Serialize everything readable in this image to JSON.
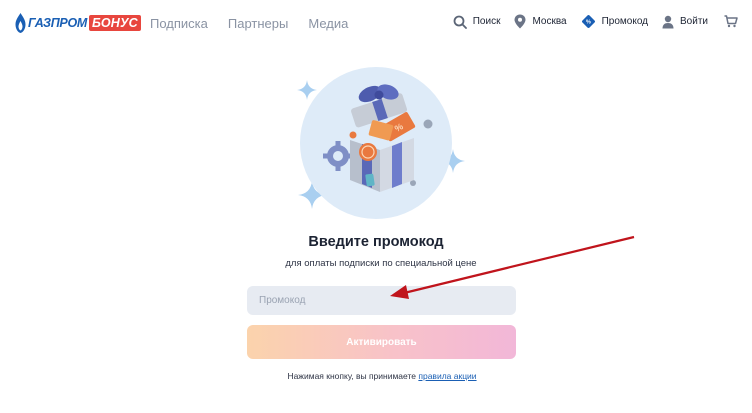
{
  "header": {
    "logo": {
      "part1": "ГАЗПРОМ",
      "part2": "БОНУС"
    },
    "nav": [
      {
        "label": "Подписка"
      },
      {
        "label": "Партнеры"
      },
      {
        "label": "Медиа"
      }
    ],
    "actions": {
      "search_label": "Поиск",
      "city_label": "Москва",
      "promo_label": "Промокод",
      "login_label": "Войти"
    }
  },
  "main": {
    "title": "Введите промокод",
    "subtitle": "для оплаты подписки по специальной цене",
    "promo_input": {
      "placeholder": "Промокод",
      "value": ""
    },
    "activate_button": "Активировать",
    "terms_prefix": "Нажимая кнопку, вы принимаете ",
    "terms_link": "правила акции"
  },
  "colors": {
    "brand_blue": "#1a5fb4",
    "brand_red": "#e8463e",
    "arrow_annotation": "#c0141c",
    "button_gradient_start": "#fbd3ac",
    "button_gradient_end": "#f2b7d8"
  },
  "icons": [
    "search-icon",
    "location-pin-icon",
    "promo-tag-icon",
    "user-icon",
    "cart-icon",
    "gas-flame-icon",
    "sparkle-icon",
    "gift-illustration",
    "arrow-annotation"
  ]
}
